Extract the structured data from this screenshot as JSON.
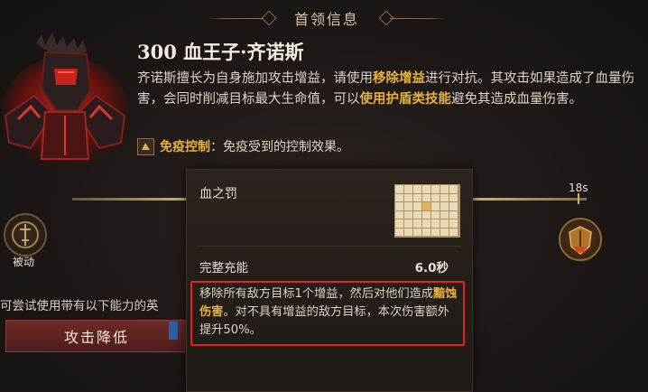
{
  "header": {
    "title": "首领信息"
  },
  "boss": {
    "name": "300 血王子·齐诺斯",
    "desc_part1": "齐诺斯擅长为自身施加攻击增益，请使用",
    "desc_hl1": "移除增益",
    "desc_part2": "进行对抗。其攻击如果造成了血量伤害，会同时削减目标最大生命值，可以",
    "desc_hl2": "使用护盾类技能",
    "desc_part3": "避免其造成血量伤害。",
    "immune_label": "免疫控制",
    "immune_text": "：免疫受到的控制效果。"
  },
  "timeline": {
    "time": "18s",
    "passive_label": "被动"
  },
  "left_panel": {
    "hint": "可尝试使用带有以下能力的英",
    "reduce_button": "攻击降低"
  },
  "tooltip": {
    "skill_name": "血之罚",
    "charge_label": "完整充能",
    "charge_value": "6.0秒",
    "desc_part1": "移除所有敌方目标1个增益，然后对他们造成",
    "desc_hl": "黯蚀伤害",
    "desc_part2": "。对不具有增益的敌方目标，本次伤害额外提升50%。"
  },
  "colors": {
    "highlight": "#e7b23f",
    "alert_border": "#e0241c",
    "button_red": "#6e2a28"
  }
}
